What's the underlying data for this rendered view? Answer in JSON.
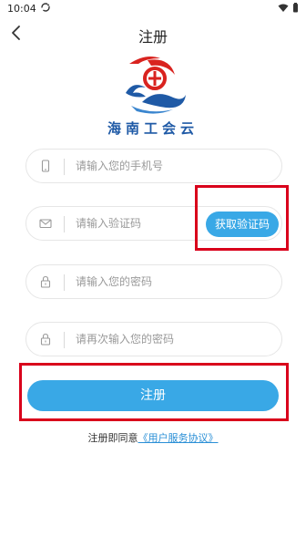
{
  "status_bar": {
    "time": "10:04"
  },
  "nav": {
    "title": "注册"
  },
  "logo": {
    "text": "海南工会云"
  },
  "form": {
    "phone_placeholder": "请输入您的手机号",
    "code_placeholder": "请输入验证码",
    "password_placeholder": "请输入您的密码",
    "confirm_placeholder": "请再次输入您的密码",
    "get_code_label": "获取验证码",
    "submit_label": "注册"
  },
  "agreement": {
    "prefix": "注册即同意",
    "link": "《用户服务协议》"
  },
  "colors": {
    "accent": "#39a8e6",
    "highlight": "#d9001b",
    "logo_blue": "#1f5aa6",
    "logo_red": "#d9231f"
  }
}
